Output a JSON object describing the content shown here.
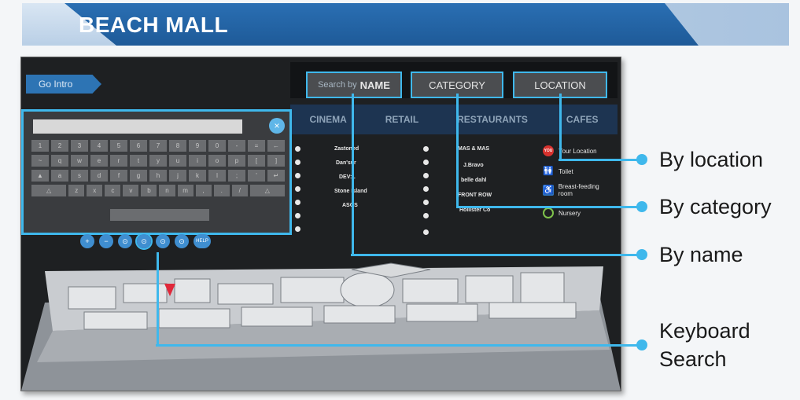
{
  "banner": {
    "title": "BEACH MALL"
  },
  "screen": {
    "go_intro_label": "Go Intro",
    "search": {
      "name_small": "Search by",
      "name_big": "NAME",
      "category": "CATEGORY",
      "location": "LOCATION"
    },
    "tabs": [
      "CINEMA",
      "RETAIL",
      "RESTAURANTS",
      "CAFES"
    ],
    "keyboard": {
      "rows": [
        [
          "1",
          "2",
          "3",
          "4",
          "5",
          "6",
          "7",
          "8",
          "9",
          "0",
          "-",
          "=",
          "←"
        ],
        [
          "~",
          "q",
          "w",
          "e",
          "r",
          "t",
          "y",
          "u",
          "i",
          "o",
          "p",
          "[",
          "]"
        ],
        [
          "▲",
          "a",
          "s",
          "d",
          "f",
          "g",
          "h",
          "j",
          "k",
          "l",
          ";",
          "'",
          "↵"
        ],
        [
          "△",
          "z",
          "x",
          "c",
          "v",
          "b",
          "n",
          "m",
          ",",
          ".",
          "/",
          "△"
        ]
      ],
      "clear_icon": "×"
    },
    "tools": [
      "+",
      "−",
      "⊙",
      "⊙",
      "⊙",
      "⊙",
      "HELP"
    ],
    "list_col1": [
      "Zastoned",
      "Dan'sur",
      "DEV:L",
      "Stone Island",
      "ASOS"
    ],
    "list_col2": [
      "MAS & MAS",
      "J.Bravo",
      "belle dahl",
      "FRONT ROW",
      "Hollister Co"
    ],
    "legend": [
      {
        "icon": "you-are-here-pin",
        "badge": "YOU",
        "label": "Your Location"
      },
      {
        "icon": "toilet-icon",
        "label": "Toilet"
      },
      {
        "icon": "breastfeeding-icon",
        "label": "Breast-feeding room"
      },
      {
        "icon": "nursery-icon",
        "label": "Nursery"
      }
    ]
  },
  "callouts": [
    {
      "label": "By location"
    },
    {
      "label": "By category"
    },
    {
      "label": "By name"
    },
    {
      "label_line1": "Keyboard",
      "label_line2": "Search"
    }
  ],
  "colors": {
    "accent": "#3fb8ec",
    "banner": "#1e5a98",
    "screen_bg": "#1e2022",
    "pin": "#d8322e"
  }
}
